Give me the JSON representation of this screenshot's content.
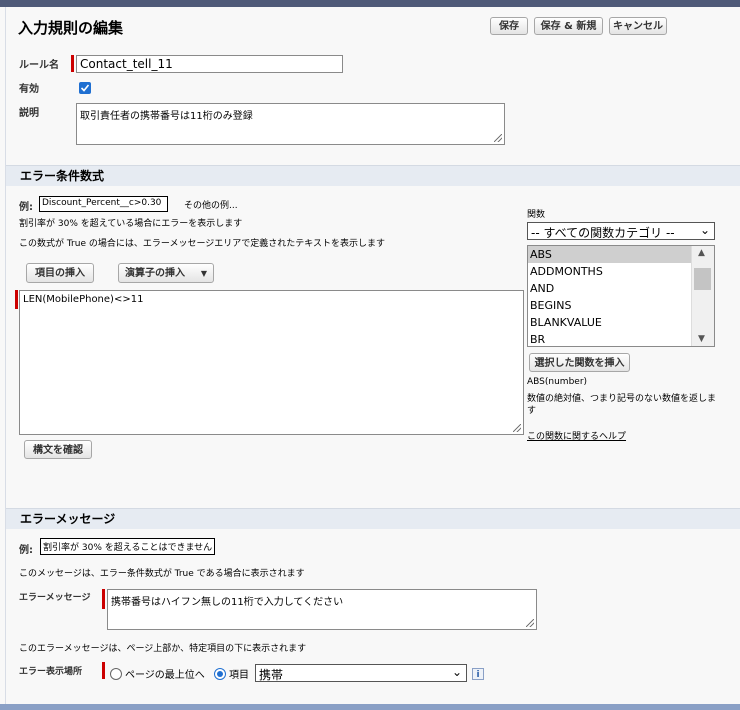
{
  "header": {
    "title": "入力規則の編集",
    "save_label": "保存",
    "save_new_label": "保存 & 新規",
    "cancel_label": "キャンセル"
  },
  "rule": {
    "name_label": "ルール名",
    "name_value": "Contact_tell_11",
    "active_label": "有効",
    "active_checked": true,
    "description_label": "説明",
    "description_value": "取引責任者の携帯番号は11桁のみ登録"
  },
  "formula_section": {
    "title": "エラー条件数式",
    "example_label": "例:",
    "example_value": "Discount_Percent__c>0.30",
    "more_examples": "その他の例...",
    "example_desc": "割引率が 30% を超えている場合にエラーを表示します",
    "true_desc": "この数式が True の場合には、エラーメッセージエリアで定義されたテキストを表示します",
    "insert_field_label": "項目の挿入",
    "insert_operator_label": "演算子の挿入",
    "formula_value": "LEN(MobilePhone)<>11",
    "check_syntax_label": "構文を確認",
    "functions_label": "関数",
    "function_category": "-- すべての関数カテゴリ --",
    "functions": [
      "ABS",
      "ADDMONTHS",
      "AND",
      "BEGINS",
      "BLANKVALUE",
      "BR"
    ],
    "insert_function_label": "選択した関数を挿入",
    "function_signature": "ABS(number)",
    "function_desc": "数値の絶対値、つまり記号のない数値を返します",
    "function_help": "この関数に関するヘルプ"
  },
  "message_section": {
    "title": "エラーメッセージ",
    "example_label": "例:",
    "example_value": "割引率が 30% を超えることはできません",
    "desc": "このメッセージは、エラー条件数式が True である場合に表示されます",
    "message_label": "エラーメッセージ",
    "message_value": "携帯番号はハイフン無しの11桁で入力してください",
    "location_desc": "このエラーメッセージは、ページ上部か、特定項目の下に表示されます",
    "location_label": "エラー表示場所",
    "option_top": "ページの最上位へ",
    "option_field": "項目",
    "field_value": "携帯"
  },
  "colors": {
    "accent": "#1f6fd1",
    "required": "#cc0000",
    "section_bg": "#e6ebf2"
  }
}
